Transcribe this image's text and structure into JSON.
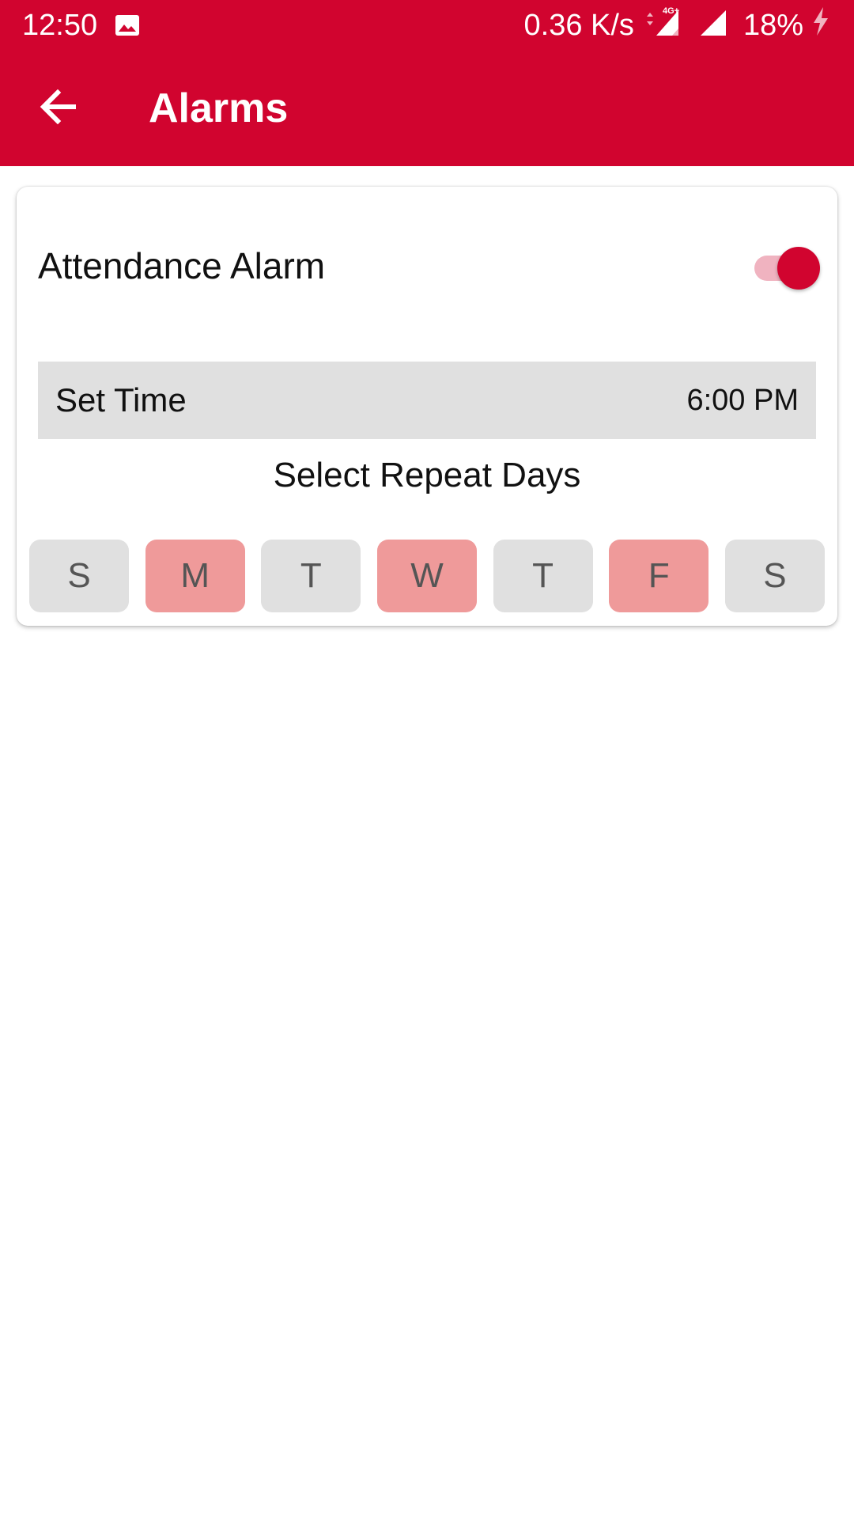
{
  "status_bar": {
    "time": "12:50",
    "net_speed": "0.36 K/s",
    "network_type": "4G+",
    "battery": "18%",
    "icons": [
      "gallery-icon",
      "signal-4g-icon",
      "signal-icon",
      "battery-charging-icon"
    ]
  },
  "app_bar": {
    "title": "Alarms",
    "back_icon": "arrow-back-icon"
  },
  "alarm": {
    "label": "Attendance Alarm",
    "enabled": true
  },
  "set_time": {
    "label": "Set Time",
    "value": "6:00 PM"
  },
  "repeat": {
    "heading": "Select Repeat Days",
    "days": [
      {
        "label": "S",
        "selected": false
      },
      {
        "label": "M",
        "selected": true
      },
      {
        "label": "T",
        "selected": false
      },
      {
        "label": "W",
        "selected": true
      },
      {
        "label": "T",
        "selected": false
      },
      {
        "label": "F",
        "selected": true
      },
      {
        "label": "S",
        "selected": false
      }
    ]
  },
  "colors": {
    "primary": "#d1042f",
    "day_selected": "#ef9a9a",
    "day_unselected": "#e0e0e0",
    "toggle_track": "#f0b3c0"
  }
}
